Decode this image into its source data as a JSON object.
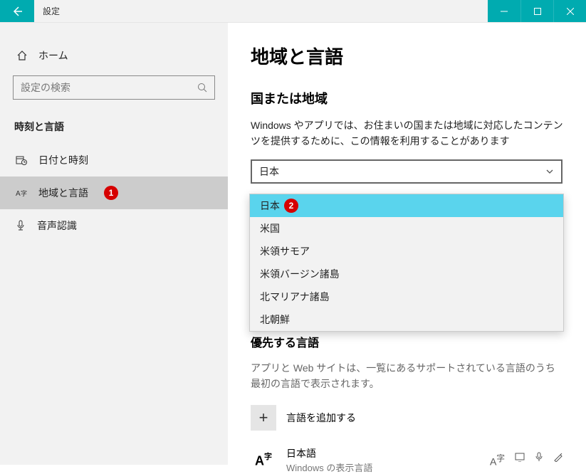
{
  "titlebar": {
    "title": "設定"
  },
  "sidebar": {
    "home": "ホーム",
    "search_placeholder": "設定の検索",
    "group": "時刻と言語",
    "items": [
      {
        "label": "日付と時刻"
      },
      {
        "label": "地域と言語"
      },
      {
        "label": "音声認識"
      }
    ],
    "badge1": "1"
  },
  "main": {
    "h1": "地域と言語",
    "h2": "国または地域",
    "desc": "Windows やアプリでは、お住まいの国または地域に対応したコンテンツを提供するために、この情報を利用することがあります",
    "select_value": "日本",
    "dropdown": [
      "日本",
      "米国",
      "米領サモア",
      "米領バージン諸島",
      "北マリアナ諸島",
      "北朝鮮"
    ],
    "badge2": "2",
    "pref_h": "優先する言語",
    "pref_desc": "アプリと Web サイトは、一覧にあるサポートされている言語のうち最初の言語で表示されます。",
    "add_lang": "言語を追加する",
    "lang_icon_text": "A",
    "lang_icon_sub": "字",
    "lang": {
      "name": "日本語",
      "sub": "Windows の表示言語"
    }
  }
}
